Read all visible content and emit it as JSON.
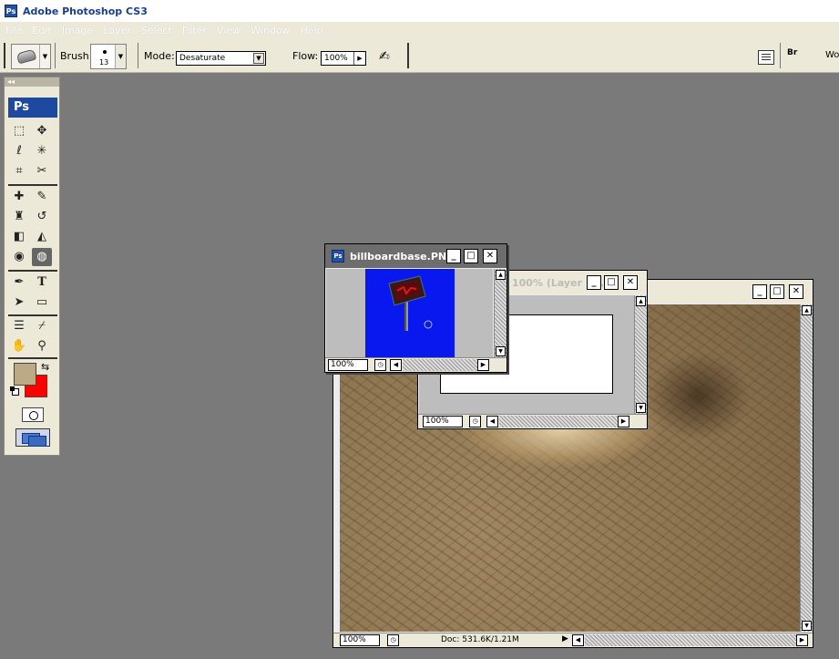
{
  "app": {
    "title": "Adobe Photoshop CS3",
    "icon_text": "Ps"
  },
  "menu": [
    "File",
    "Edit",
    "Image",
    "Layer",
    "Select",
    "Filter",
    "View",
    "Window",
    "Help"
  ],
  "options": {
    "brush_label": "Brush:",
    "brush_size": "13",
    "mode_label": "Mode:",
    "mode_value": "Desaturate",
    "flow_label": "Flow:",
    "flow_value": "100%",
    "workspace_label": "Wo",
    "bridge_label": "Br"
  },
  "toolbox": {
    "collapse": "◂◂",
    "logo": "Ps",
    "foreground_color": "#bca985",
    "background_color": "#ff0000"
  },
  "windows": {
    "billboard": {
      "title": "billboardbase.PNG ...",
      "zoom": "100%",
      "canvas_color": "#0a18f0"
    },
    "layer": {
      "title": "100% (Layer 1...",
      "zoom": "100%"
    },
    "main": {
      "zoom": "100%",
      "doc_info": "Doc: 531.6K/1.21M"
    }
  },
  "window_buttons": {
    "minimize": "_",
    "maximize": "□",
    "close": "✕"
  }
}
